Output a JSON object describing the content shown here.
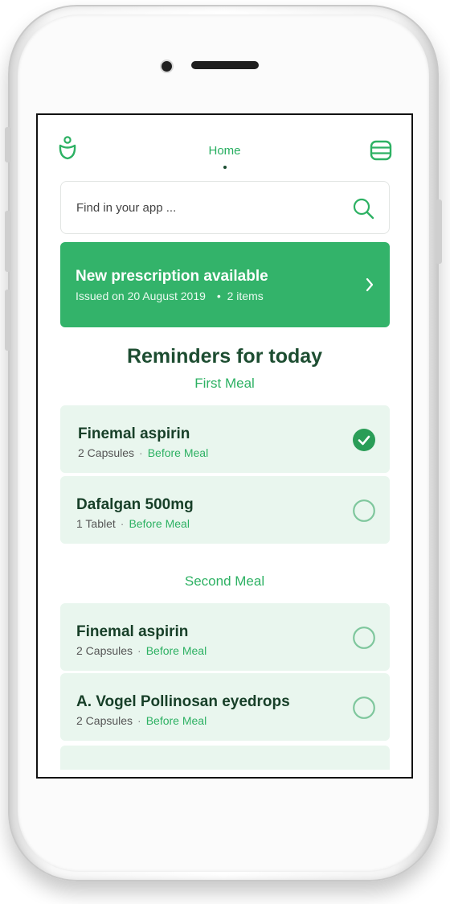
{
  "colors": {
    "accent": "#33b36a",
    "accent_text": "#2db163",
    "dark_text": "#173f28",
    "card_bg": "#e9f6ee"
  },
  "header": {
    "title": "Home",
    "logo_icon": "user-icon",
    "menu_icon": "stack-icon"
  },
  "search": {
    "placeholder": "Find in your app ...",
    "icon": "search-icon"
  },
  "banner": {
    "title": "New prescription available",
    "issued": "Issued on 20 August 2019",
    "separator": "•",
    "items": "2 items",
    "icon": "chevron-right-icon"
  },
  "reminders": {
    "title": "Reminders for today",
    "meals": [
      {
        "label": "First Meal",
        "items": [
          {
            "name": "Finemal aspirin",
            "dose": "2 Capsules",
            "separator": "·",
            "timing": "Before Meal",
            "done": true
          },
          {
            "name": "Dafalgan 500mg",
            "dose": "1 Tablet",
            "separator": "·",
            "timing": "Before Meal",
            "done": false
          }
        ]
      },
      {
        "label": "Second Meal",
        "items": [
          {
            "name": "Finemal aspirin",
            "dose": "2 Capsules",
            "separator": "·",
            "timing": "Before Meal",
            "done": false
          },
          {
            "name": "A. Vogel Pollinosan eyedrops",
            "dose": "2 Capsules",
            "separator": "·",
            "timing": "Before Meal",
            "done": false
          }
        ]
      }
    ]
  }
}
